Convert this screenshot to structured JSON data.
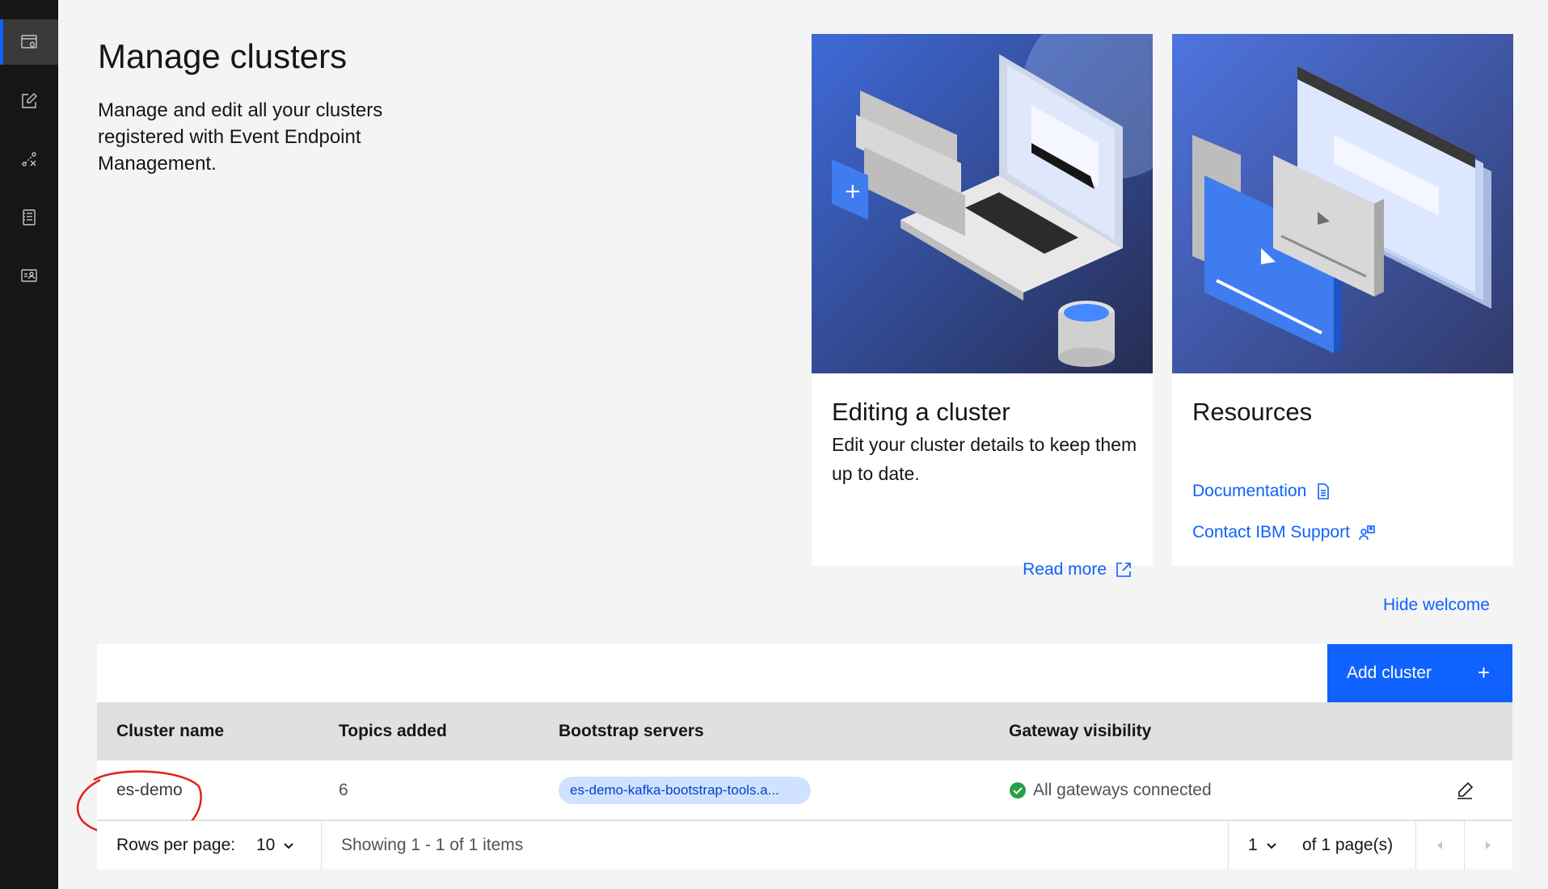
{
  "sidebar": {
    "items": [
      {
        "icon": "cluster-settings-icon",
        "active": true
      },
      {
        "icon": "edit-document-icon",
        "active": false
      },
      {
        "icon": "tools-icon",
        "active": false
      },
      {
        "icon": "catalog-icon",
        "active": false
      },
      {
        "icon": "user-profile-icon",
        "active": false
      }
    ]
  },
  "page": {
    "title": "Manage clusters",
    "description": "Manage and edit all your clusters registered with Event Endpoint Management."
  },
  "cards": {
    "editing": {
      "title": "Editing a cluster",
      "description": "Edit your cluster details to keep them up to date.",
      "link": "Read more",
      "link_icon": "launch-icon"
    },
    "resources": {
      "title": "Resources",
      "links": [
        {
          "label": "Documentation",
          "icon": "document-icon"
        },
        {
          "label": "Contact IBM Support",
          "icon": "support-icon"
        }
      ]
    }
  },
  "hide_welcome": "Hide welcome",
  "table": {
    "add_button": "Add cluster",
    "add_icon": "+",
    "headers": [
      "Cluster name",
      "Topics added",
      "Bootstrap servers",
      "Gateway visibility"
    ],
    "rows": [
      {
        "cluster_name": "es-demo",
        "topics_added": "6",
        "bootstrap": "es-demo-kafka-bootstrap-tools.a...",
        "gateway": "All gateways connected"
      }
    ],
    "pagination": {
      "rows_per_page_label": "Rows per page:",
      "rows_per_page": "10",
      "showing": "Showing 1 - 1 of 1 items",
      "page": "1",
      "of_pages": "of 1 page(s)"
    }
  },
  "colors": {
    "accent": "#0f62fe",
    "sidebar_bg": "#161616",
    "success": "#24a148",
    "annotation": "#e0201b"
  }
}
